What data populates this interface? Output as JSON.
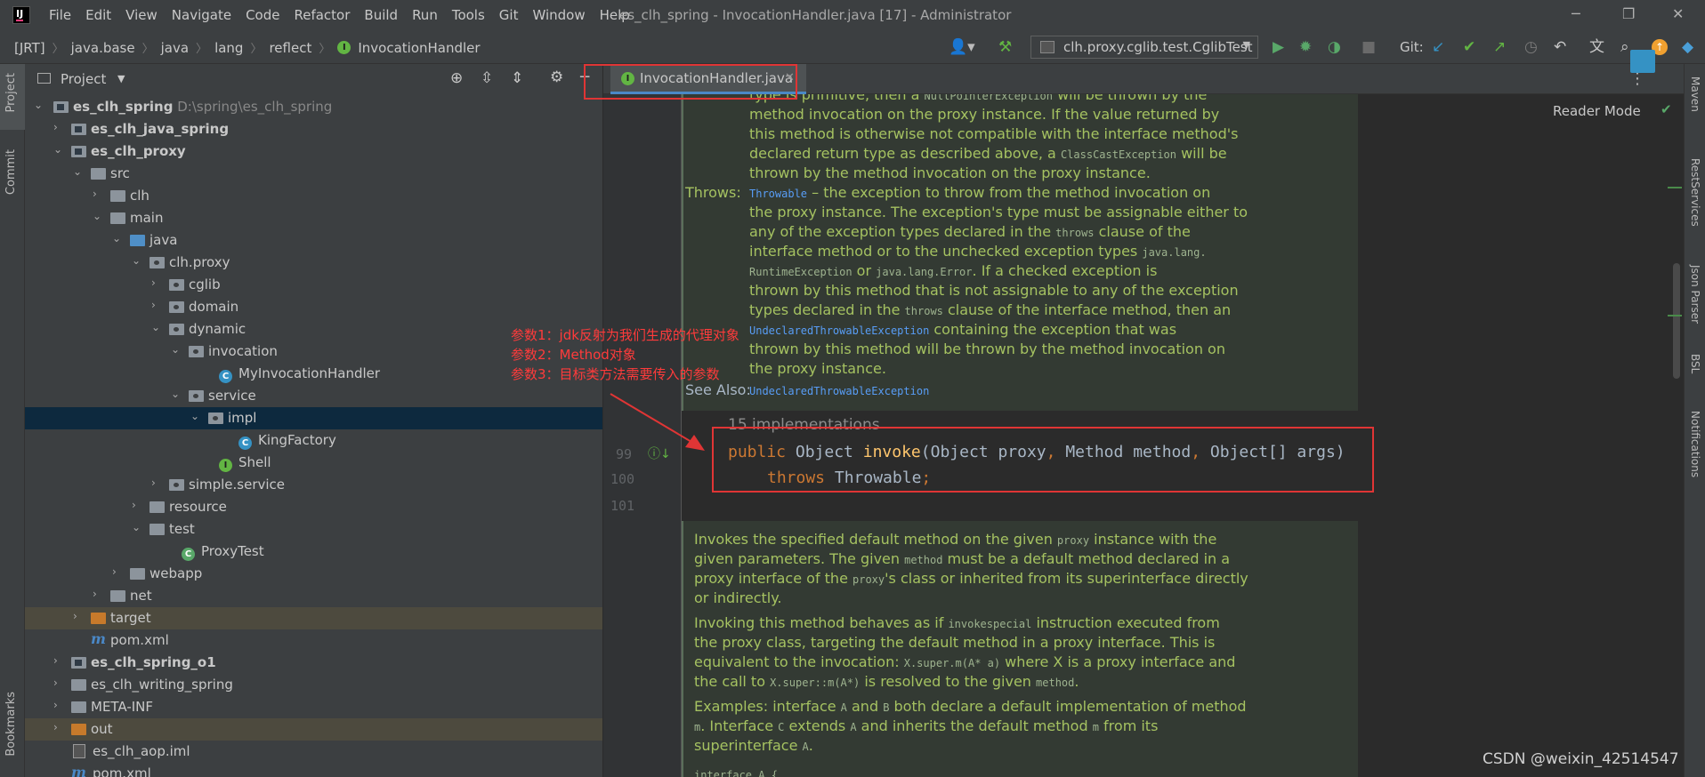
{
  "titlebar": {
    "menu": [
      "File",
      "Edit",
      "View",
      "Navigate",
      "Code",
      "Refactor",
      "Build",
      "Run",
      "Tools",
      "Git",
      "Window",
      "Help"
    ],
    "window_title": "es_clh_spring - InvocationHandler.java [17] - Administrator"
  },
  "navbar": {
    "breadcrumbs": [
      "[JRT]",
      "java.base",
      "java",
      "lang",
      "reflect",
      "InvocationHandler"
    ],
    "run_config": "clh.proxy.cglib.test.CglibTest",
    "git_label": "Git:"
  },
  "left_strip": {
    "project": "Project",
    "commit": "Commit",
    "bookmarks": "Bookmarks"
  },
  "right_strip": {
    "maven": "Maven",
    "rest": "RestServices",
    "json": "Json Parser",
    "bsl": "BSL",
    "notifications": "Notifications"
  },
  "project": {
    "title": "Project",
    "tree": [
      {
        "label": "es_clh_spring",
        "extra": "D:\\spring\\es_clh_spring"
      },
      {
        "label": "es_clh_java_spring"
      },
      {
        "label": "es_clh_proxy"
      },
      {
        "label": "src"
      },
      {
        "label": "clh"
      },
      {
        "label": "main"
      },
      {
        "label": "java"
      },
      {
        "label": "clh.proxy"
      },
      {
        "label": "cglib"
      },
      {
        "label": "domain"
      },
      {
        "label": "dynamic"
      },
      {
        "label": "invocation"
      },
      {
        "label": "MyInvocationHandler"
      },
      {
        "label": "service"
      },
      {
        "label": "impl"
      },
      {
        "label": "KingFactory"
      },
      {
        "label": "Shell"
      },
      {
        "label": "simple.service"
      },
      {
        "label": "resource"
      },
      {
        "label": "test"
      },
      {
        "label": "ProxyTest"
      },
      {
        "label": "webapp"
      },
      {
        "label": "net"
      },
      {
        "label": "target"
      },
      {
        "label": "pom.xml"
      },
      {
        "label": "es_clh_spring_o1"
      },
      {
        "label": "es_clh_writing_spring"
      },
      {
        "label": "META-INF"
      },
      {
        "label": "out"
      },
      {
        "label": "es_clh_aop.iml"
      },
      {
        "label": "pom.xml"
      }
    ]
  },
  "editor": {
    "tab_label": "InvocationHandler.java",
    "reader_mode": "Reader Mode",
    "doc_top": {
      "p1": [
        "type is primitive, then a ",
        "NullPointerException",
        " will be thrown by the"
      ],
      "p2": "method invocation on the proxy instance. If the value returned by",
      "p3": "this method is otherwise not compatible with the interface method's",
      "p4": "declared return type as described above, a ",
      "p4_code": "ClassCastException",
      "p4_end": " will be",
      "p5": "thrown by the method invocation on the proxy instance.",
      "throws_label": "Throws:",
      "throws_link": "Throwable",
      "throws_l1": " – the exception to throw from the method invocation on",
      "throws_l2": "the proxy instance. The exception's type must be assignable either to",
      "throws_l3a": "any of the exception types declared in the ",
      "throws_l3_code": "throws",
      "throws_l3b": " clause of the",
      "throws_l4a": "interface method or to the unchecked exception types ",
      "throws_l4_code": "java.lang.",
      "throws_l5_code": "RuntimeException",
      "throws_l5_or": " or ",
      "throws_l5_code2": "java.lang.Error",
      "throws_l5b": ". If a checked exception is",
      "throws_l6": "thrown by this method that is not assignable to any of the exception",
      "throws_l7a": "types declared in the ",
      "throws_l7_code": "throws",
      "throws_l7b": " clause of the interface method, then an",
      "throws_l8_link": "UndeclaredThrowableException",
      "throws_l8b": " containing the exception that was",
      "throws_l9": "thrown by this method will be thrown by the method invocation on",
      "throws_l10": "the proxy instance.",
      "see_also_label": "See Also:",
      "see_also_link": "UndeclaredThrowableException"
    },
    "implementations": "15 implementations",
    "line_numbers": [
      "99",
      "100",
      "101"
    ],
    "code": {
      "l1_public": "public",
      "l1_type": " Object ",
      "l1_fn": "invoke",
      "l1_p1": "(Object proxy",
      "l1_c1": ",",
      "l1_p2": " Method method",
      "l1_c2": ",",
      "l1_p3": " Object[] args)",
      "l2_throws": "throws",
      "l2_rest": " Throwable",
      "l2_semi": ";"
    },
    "doc_bottom": {
      "a1a": "Invokes the specified default method on the given ",
      "a1_code": "proxy",
      "a1b": " instance with the",
      "a2a": "given parameters. The given ",
      "a2_code": "method",
      "a2b": " must be a default method declared in a",
      "a3a": "proxy interface of the ",
      "a3_code": "proxy",
      "a3b": "'s class or inherited from its superinterface directly",
      "a4": "or indirectly.",
      "b1a": "Invoking this method behaves as if ",
      "b1_code": "invokespecial",
      "b1b": " instruction executed from",
      "b2": "the proxy class, targeting the default method in a proxy interface. This is",
      "b3a": "equivalent to the invocation: ",
      "b3_code": "X.super.m(A* a)",
      "b3b": " where X is a proxy interface and",
      "b4a": "the call to ",
      "b4_code": "X.super::m(A*)",
      "b4b": " is resolved to the given ",
      "b4_code2": "method",
      "b4c": ".",
      "c1a": "Examples: interface ",
      "c1_code": "A",
      "c1b": " and ",
      "c1_code2": "B",
      "c1c": " both declare a default implementation of method",
      "c2_code": "m",
      "c2a": ". Interface ",
      "c2_code2": "C",
      "c2b": " extends ",
      "c2_code3": "A",
      "c2c": " and inherits the default method ",
      "c2_code4": "m",
      "c2d": " from its",
      "c3a": "superinterface ",
      "c3_code": "A",
      "c3b": ".",
      "d1_code": "interface A {"
    }
  },
  "annotation": {
    "lines": [
      "参数1：jdk反射为我们生成的代理对象",
      "参数2：Method对象",
      "参数3：目标类方法需要传入的参数"
    ],
    "color": "#ff3b3b"
  },
  "watermark": "CSDN @weixin_42514547"
}
